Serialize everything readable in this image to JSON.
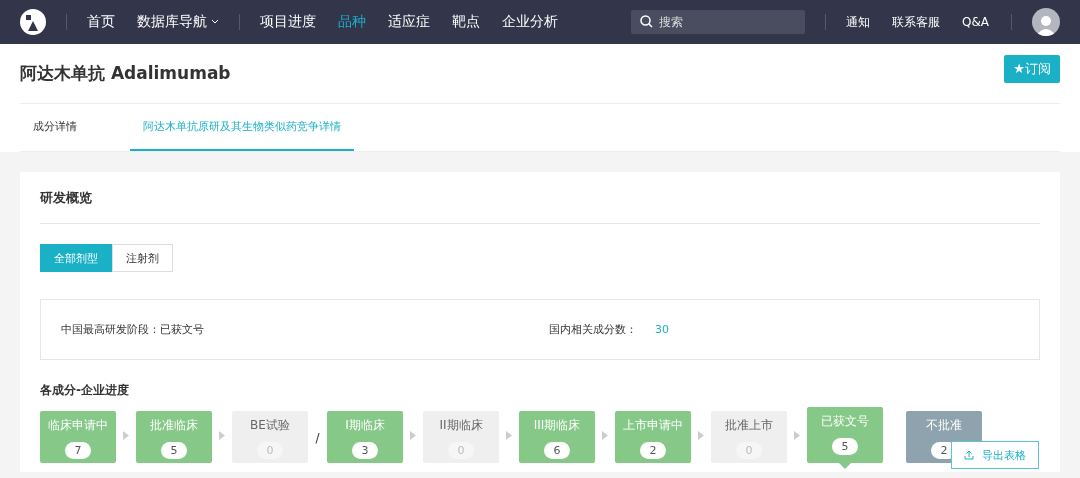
{
  "nav": {
    "items": [
      {
        "label": "首页",
        "selected": false,
        "dropdown": false
      },
      {
        "label": "数据库导航",
        "selected": false,
        "dropdown": true
      },
      {
        "label": "项目进度",
        "selected": false,
        "dropdown": false
      },
      {
        "label": "品种",
        "selected": true,
        "dropdown": false
      },
      {
        "label": "适应症",
        "selected": false,
        "dropdown": false
      },
      {
        "label": "靶点",
        "selected": false,
        "dropdown": false
      },
      {
        "label": "企业分析",
        "selected": false,
        "dropdown": false
      }
    ],
    "search": {
      "placeholder": "搜索"
    },
    "links": [
      "通知",
      "联系客服",
      "Q&A"
    ]
  },
  "header": {
    "title": "阿达木单抗 Adalimumab",
    "subscribe": "★订阅"
  },
  "tabs": [
    {
      "label": "成分详情",
      "selected": false
    },
    {
      "label": "阿达木单抗原研及其生物类似药竞争详情",
      "selected": true
    }
  ],
  "overview": {
    "title": "研发概览",
    "filters": [
      {
        "label": "全部剂型",
        "selected": true
      },
      {
        "label": "注射剂",
        "selected": false
      }
    ],
    "info": [
      {
        "label": "中国最高研发阶段：",
        "value": "已获文号",
        "link": false
      },
      {
        "label": "国内相关成分数：",
        "value": "30",
        "link": true
      }
    ]
  },
  "progress": {
    "title": "各成分-企业进度",
    "items": [
      {
        "kind": "stage",
        "label": "临床申请中",
        "count": "7",
        "reached": true,
        "rejected": false,
        "selected": false
      },
      {
        "kind": "arrow"
      },
      {
        "kind": "stage",
        "label": "批准临床",
        "count": "5",
        "reached": true,
        "rejected": false,
        "selected": false
      },
      {
        "kind": "arrow"
      },
      {
        "kind": "stage",
        "label": "BE试验",
        "count": "0",
        "reached": false,
        "rejected": false,
        "selected": false
      },
      {
        "kind": "slash",
        "text": "/"
      },
      {
        "kind": "stage",
        "label": "I期临床",
        "count": "3",
        "reached": true,
        "rejected": false,
        "selected": false
      },
      {
        "kind": "arrow"
      },
      {
        "kind": "stage",
        "label": "II期临床",
        "count": "0",
        "reached": false,
        "rejected": false,
        "selected": false
      },
      {
        "kind": "arrow"
      },
      {
        "kind": "stage",
        "label": "III期临床",
        "count": "6",
        "reached": true,
        "rejected": false,
        "selected": false
      },
      {
        "kind": "arrow"
      },
      {
        "kind": "stage",
        "label": "上市申请中",
        "count": "2",
        "reached": true,
        "rejected": false,
        "selected": false
      },
      {
        "kind": "arrow"
      },
      {
        "kind": "stage",
        "label": "批准上市",
        "count": "0",
        "reached": false,
        "rejected": false,
        "selected": false
      },
      {
        "kind": "arrow"
      },
      {
        "kind": "stage",
        "label": "已获文号",
        "count": "5",
        "reached": true,
        "rejected": false,
        "selected": true
      },
      {
        "kind": "gap"
      },
      {
        "kind": "stage",
        "label": "不批准",
        "count": "2",
        "reached": true,
        "rejected": true,
        "selected": false
      }
    ],
    "export": "导出表格"
  }
}
